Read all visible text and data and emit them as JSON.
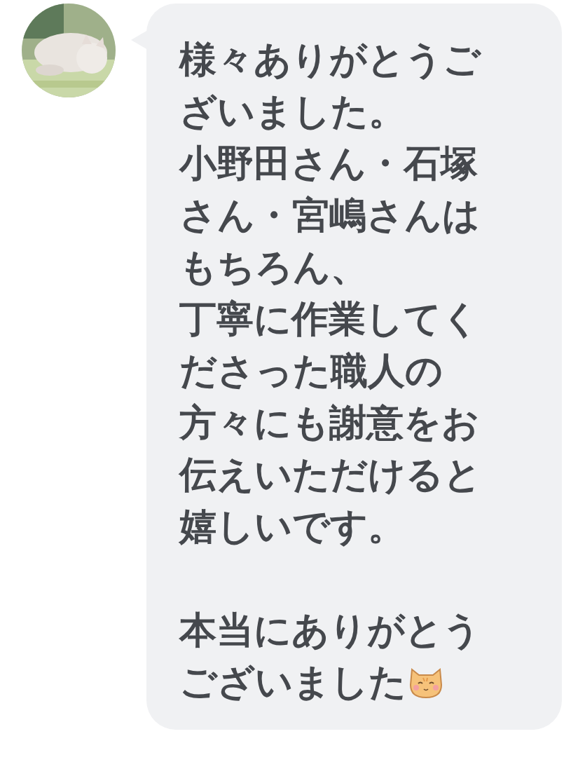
{
  "message": {
    "paragraphs": [
      {
        "lines": [
          "様々ありがとうご",
          "ざいました。",
          "小野田さん・石塚",
          "さん・宮嶋さんは",
          "もちろん、",
          "丁寧に作業してく",
          "ださった職人の",
          "方々にも謝意をお",
          "伝えいただけると",
          "嬉しいです。"
        ]
      },
      {
        "lines": [
          "本当にありがとう",
          "ございました"
        ]
      }
    ],
    "sticker": {
      "kind": "cat-emoji"
    }
  }
}
